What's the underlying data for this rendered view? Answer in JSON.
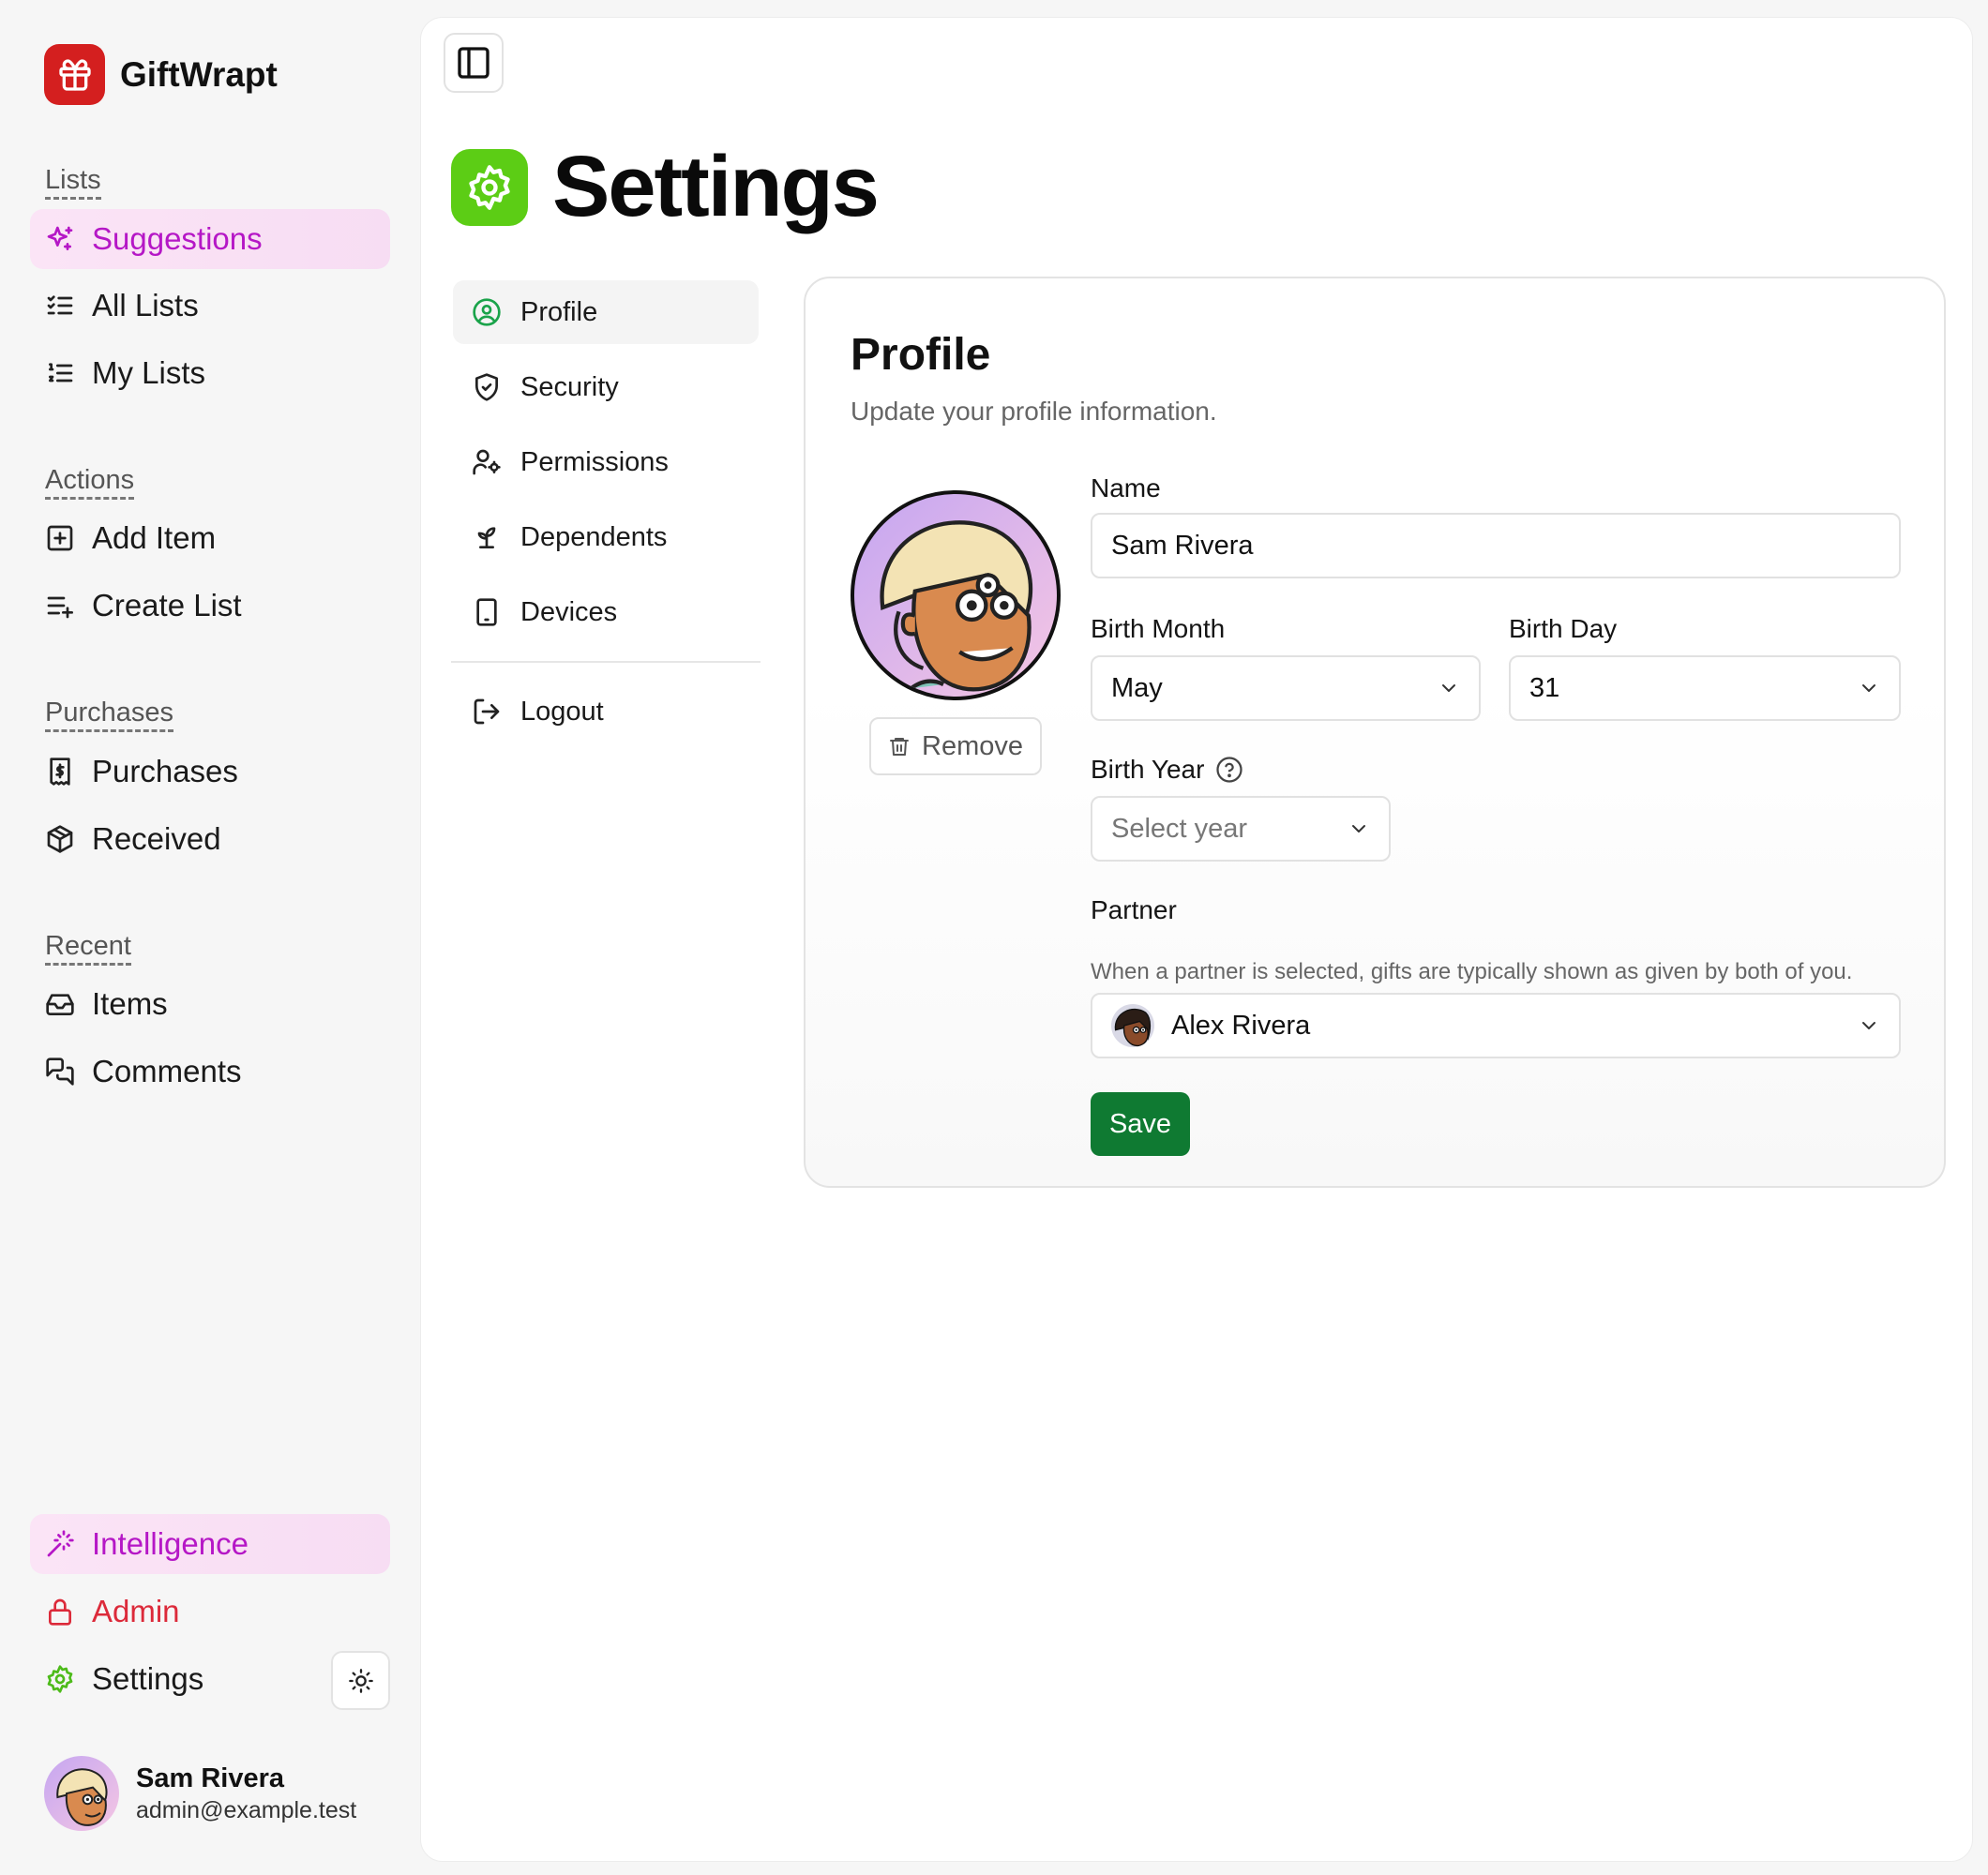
{
  "brand": {
    "name": "GiftWrapt",
    "logo_icon": "gift-icon",
    "logo_color": "#d41f1f"
  },
  "sidebar": {
    "sections": [
      {
        "label": "Lists",
        "items": [
          {
            "label": "Suggestions",
            "icon": "sparkles-icon",
            "active": true
          },
          {
            "label": "All Lists",
            "icon": "list-checks-icon"
          },
          {
            "label": "My Lists",
            "icon": "list-ordered-icon"
          }
        ]
      },
      {
        "label": "Actions",
        "items": [
          {
            "label": "Add Item",
            "icon": "square-plus-icon"
          },
          {
            "label": "Create List",
            "icon": "list-plus-icon"
          }
        ]
      },
      {
        "label": "Purchases",
        "items": [
          {
            "label": "Purchases",
            "icon": "receipt-icon"
          },
          {
            "label": "Received",
            "icon": "package-icon"
          }
        ]
      },
      {
        "label": "Recent",
        "items": [
          {
            "label": "Items",
            "icon": "inbox-icon"
          },
          {
            "label": "Comments",
            "icon": "messages-icon"
          }
        ]
      }
    ],
    "bottom": [
      {
        "label": "Intelligence",
        "icon": "wand-icon",
        "active": true
      },
      {
        "label": "Admin",
        "icon": "lock-icon"
      },
      {
        "label": "Settings",
        "icon": "gear-icon"
      }
    ],
    "theme_toggle_icon": "sun-icon",
    "user": {
      "name": "Sam Rivera",
      "email": "admin@example.test"
    }
  },
  "page": {
    "title": "Settings",
    "icon": "gear-icon",
    "accent": "#5ccd15",
    "subnav": [
      {
        "label": "Profile",
        "icon": "user-circle-icon",
        "active": true
      },
      {
        "label": "Security",
        "icon": "shield-icon"
      },
      {
        "label": "Permissions",
        "icon": "user-cog-icon"
      },
      {
        "label": "Dependents",
        "icon": "sprout-icon"
      },
      {
        "label": "Devices",
        "icon": "tablet-icon"
      }
    ],
    "logout": {
      "label": "Logout",
      "icon": "logout-icon"
    }
  },
  "profile": {
    "title": "Profile",
    "subtitle": "Update your profile information.",
    "remove_label": "Remove",
    "name": {
      "label": "Name",
      "value": "Sam Rivera"
    },
    "birth_month": {
      "label": "Birth Month",
      "value": "May"
    },
    "birth_day": {
      "label": "Birth Day",
      "value": "31"
    },
    "birth_year": {
      "label": "Birth Year",
      "placeholder": "Select year"
    },
    "partner": {
      "label": "Partner",
      "hint": "When a partner is selected, gifts are typically shown as given by both of you.",
      "value": "Alex Rivera"
    },
    "save_label": "Save",
    "save_color": "#0f7a32"
  }
}
